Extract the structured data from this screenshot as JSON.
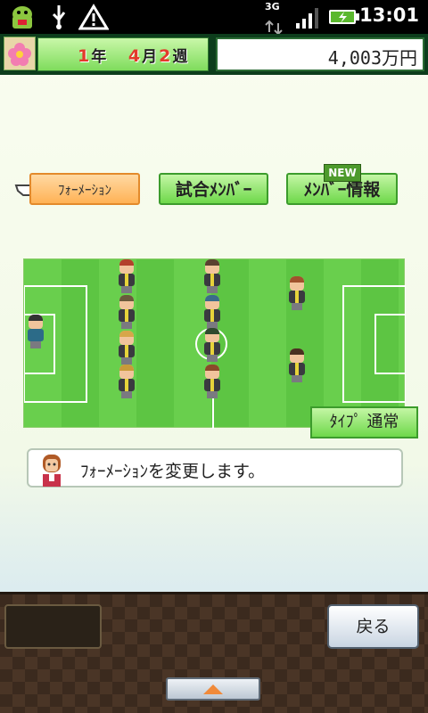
{
  "status": {
    "time": "13:01",
    "network": "3G"
  },
  "header": {
    "year_num": "1",
    "year_unit": "年",
    "month_num": "4",
    "month_unit": "月",
    "week_num": "2",
    "week_unit": "週",
    "money": "4,003万円"
  },
  "tabs": {
    "formation": "ﾌｫｰﾒｰｼｮﾝ",
    "match_members": "試合ﾒﾝﾊﾞｰ",
    "member_info": "ﾒﾝﾊﾞｰ情報",
    "new_badge": "NEW"
  },
  "pitch": {
    "type_button": "ﾀｲﾌﾟ 通常"
  },
  "message": {
    "text": "ﾌｫｰﾒｰｼｮﾝを変更します。"
  },
  "footer": {
    "back_label": "戻る"
  },
  "colors": {
    "pitch_light": "#69cf4d",
    "pitch_dark": "#5dc543",
    "tab_active": "#ffb255",
    "tab_inactive": "#6ed84a"
  }
}
